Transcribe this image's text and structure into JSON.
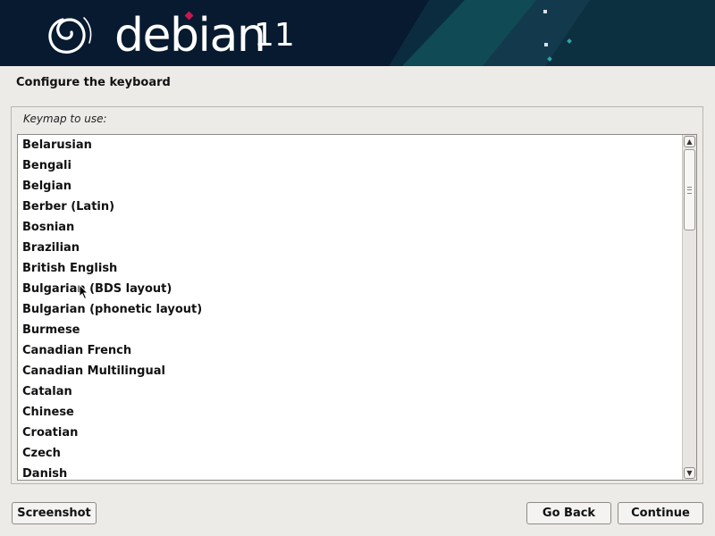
{
  "banner": {
    "brand_name": "debian",
    "version": "11",
    "logo_icon": "debian-swirl-icon",
    "colors": {
      "background": "#071a30",
      "accent_teal": "#0f4a55",
      "logo_dot": "#c7174e"
    }
  },
  "page": {
    "title": "Configure the keyboard"
  },
  "keymap": {
    "label": "Keymap to use:",
    "items": [
      "Belarusian",
      "Bengali",
      "Belgian",
      "Berber (Latin)",
      "Bosnian",
      "Brazilian",
      "British English",
      "Bulgarian (BDS layout)",
      "Bulgarian (phonetic layout)",
      "Burmese",
      "Canadian French",
      "Canadian Multilingual",
      "Catalan",
      "Chinese",
      "Croatian",
      "Czech",
      "Danish"
    ]
  },
  "scrollbar": {
    "up_icon": "▲",
    "down_icon": "▼"
  },
  "buttons": {
    "screenshot": "Screenshot",
    "go_back": "Go Back",
    "continue": "Continue"
  }
}
